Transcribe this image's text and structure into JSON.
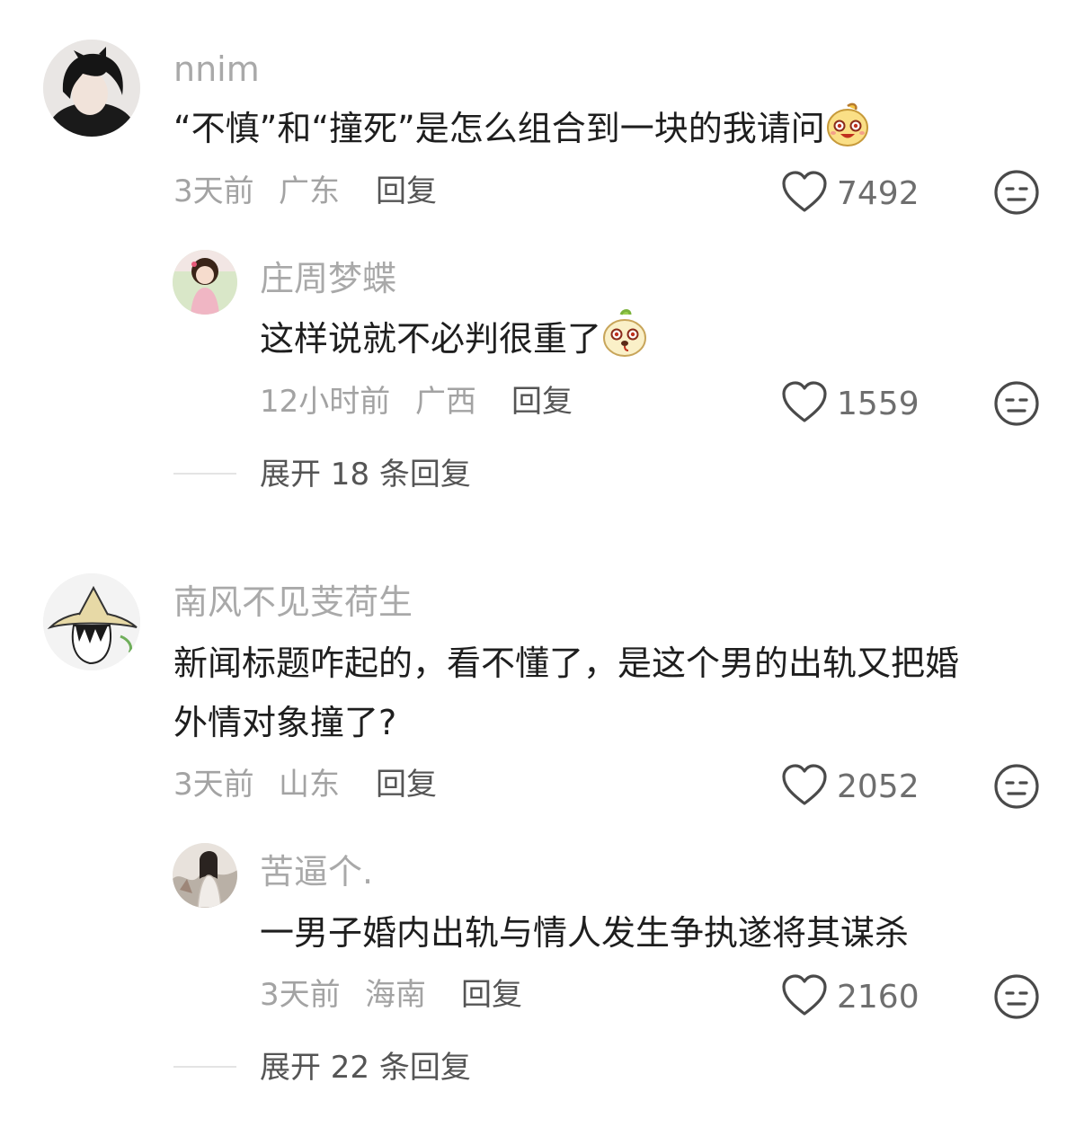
{
  "comments": [
    {
      "username": "nnim",
      "text": "“不慎”和“撞死”是怎么组合到一块的我请问",
      "emoji": "smiling-bun-emoji",
      "time": "3天前",
      "location": "广东",
      "reply_label": "回复",
      "likes": "7492",
      "reply": {
        "username": "庄周梦蝶",
        "text": "这样说就不必判很重了",
        "emoji": "dog-bun-emoji",
        "time": "12小时前",
        "location": "广西",
        "reply_label": "回复",
        "likes": "1559"
      },
      "expand_label": "展开 18 条回复"
    },
    {
      "username": "南风不见芰荷生",
      "text_line1": "新闻标题咋起的，看不懂了，是这个男的出轨又把婚",
      "text_line2": "外情对象撞了?",
      "time": "3天前",
      "location": "山东",
      "reply_label": "回复",
      "likes": "2052",
      "reply": {
        "username": "苦逼个.",
        "text": "一男子婚内出轨与情人发生争执遂将其谋杀",
        "time": "3天前",
        "location": "海南",
        "reply_label": "回复",
        "likes": "2160"
      },
      "expand_label": "展开 22 条回复"
    }
  ],
  "colors": {
    "username": "#a9a9a9",
    "text": "#1e1e1e",
    "meta": "#a3a3a3",
    "action": "#555555"
  }
}
